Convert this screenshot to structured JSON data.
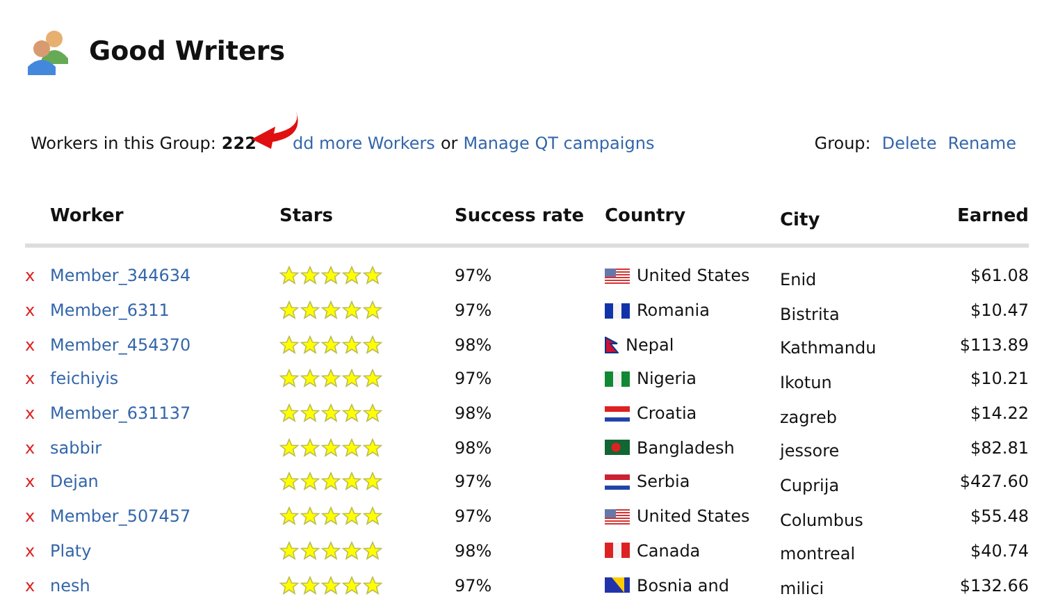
{
  "title": "Good Writers",
  "summary": {
    "label": "Workers in this Group:",
    "count": "222",
    "add_link": "dd more Workers",
    "joiner": "or",
    "manage_link": "Manage QT campaigns"
  },
  "group_actions": {
    "label": "Group:",
    "links": [
      "Delete",
      "Rename"
    ]
  },
  "table": {
    "columns": [
      "Worker",
      "Stars",
      "Success rate",
      "Country",
      "City",
      "Earned"
    ],
    "rows": [
      {
        "remove": "x",
        "worker": "Member_344634",
        "stars": 5,
        "success": "97%",
        "flag": {
          "kind": "stars",
          "color": "#d33333"
        },
        "country": "United States",
        "city": "Enid",
        "earned": "$61.08"
      },
      {
        "remove": "x",
        "worker": "Member_6311",
        "stars": 5,
        "success": "97%",
        "flag": {
          "kind": "tricolor",
          "color": "#1133aa"
        },
        "country": "Romania",
        "city": "Bistrita",
        "earned": "$10.47"
      },
      {
        "remove": "x",
        "worker": "Member_454370",
        "stars": 5,
        "success": "98%",
        "flag": {
          "kind": "pennant",
          "color": "#cc1133"
        },
        "country": "Nepal",
        "city": "Kathmandu",
        "earned": "$113.89"
      },
      {
        "remove": "x",
        "worker": "feichiyis",
        "stars": 5,
        "success": "97%",
        "flag": {
          "kind": "tricolor",
          "color": "#118833"
        },
        "country": "Nigeria",
        "city": "Ikotun",
        "earned": "$10.21"
      },
      {
        "remove": "x",
        "worker": "Member_631137",
        "stars": 5,
        "success": "98%",
        "flag": {
          "kind": "bands",
          "color": "#dd2222"
        },
        "country": "Croatia",
        "city": "zagreb",
        "earned": "$14.22"
      },
      {
        "remove": "x",
        "worker": "sabbir",
        "stars": 5,
        "success": "98%",
        "flag": {
          "kind": "disc",
          "color": "#116633"
        },
        "country": "Bangladesh",
        "city": "jessore",
        "earned": "$82.81"
      },
      {
        "remove": "x",
        "worker": "Dejan",
        "stars": 5,
        "success": "97%",
        "flag": {
          "kind": "bands",
          "color": "#cc2233"
        },
        "country": "Serbia",
        "city": "Cuprija",
        "earned": "$427.60"
      },
      {
        "remove": "x",
        "worker": "Member_507457",
        "stars": 5,
        "success": "97%",
        "flag": {
          "kind": "stars",
          "color": "#d33333"
        },
        "country": "United States",
        "city": "Columbus",
        "earned": "$55.48"
      },
      {
        "remove": "x",
        "worker": "Platy",
        "stars": 5,
        "success": "98%",
        "flag": {
          "kind": "tricolor",
          "color": "#dd2222"
        },
        "country": "Canada",
        "city": "montreal",
        "earned": "$40.74"
      },
      {
        "remove": "x",
        "worker": "nesh",
        "stars": 5,
        "success": "97%",
        "flag": {
          "kind": "diagonal",
          "color": "#2233aa"
        },
        "country": "Bosnia and",
        "city": "milici",
        "earned": "$132.66"
      }
    ]
  }
}
